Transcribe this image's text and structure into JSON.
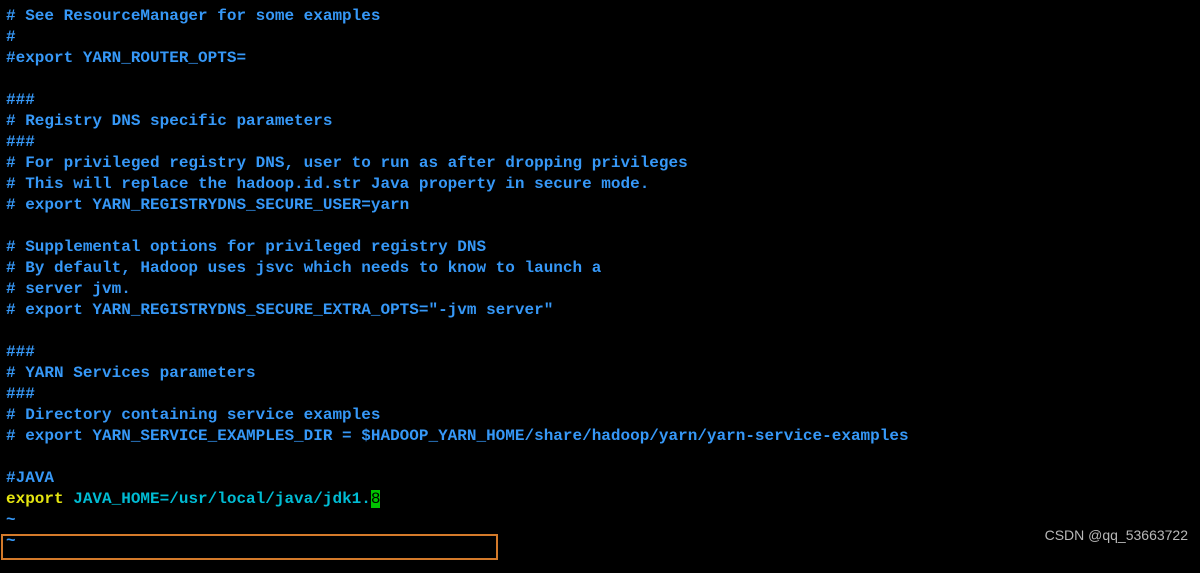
{
  "comments": {
    "l1": "# See ResourceManager for some examples",
    "l2": "#",
    "l3": "#export YARN_ROUTER_OPTS=",
    "l4": "",
    "l5": "###",
    "l6": "# Registry DNS specific parameters",
    "l7": "###",
    "l8": "# For privileged registry DNS, user to run as after dropping privileges",
    "l9": "# This will replace the hadoop.id.str Java property in secure mode.",
    "l10": "# export YARN_REGISTRYDNS_SECURE_USER=yarn",
    "l11": "",
    "l12": "# Supplemental options for privileged registry DNS",
    "l13": "# By default, Hadoop uses jsvc which needs to know to launch a",
    "l14": "# server jvm.",
    "l15": "# export YARN_REGISTRYDNS_SECURE_EXTRA_OPTS=\"-jvm server\"",
    "l16": "",
    "l17": "###",
    "l18": "# YARN Services parameters",
    "l19": "###",
    "l20": "# Directory containing service examples",
    "l21": "# export YARN_SERVICE_EXAMPLES_DIR = $HADOOP_YARN_HOME/share/hadoop/yarn/yarn-service-examples",
    "l22": "",
    "l23": "#JAVA"
  },
  "export_line": {
    "keyword": "export",
    "space": " ",
    "assign": "JAVA_HOME=/usr/local/java/jdk1.",
    "cursor_char": "8"
  },
  "tilde": "~",
  "watermark": "CSDN @qq_53663722"
}
